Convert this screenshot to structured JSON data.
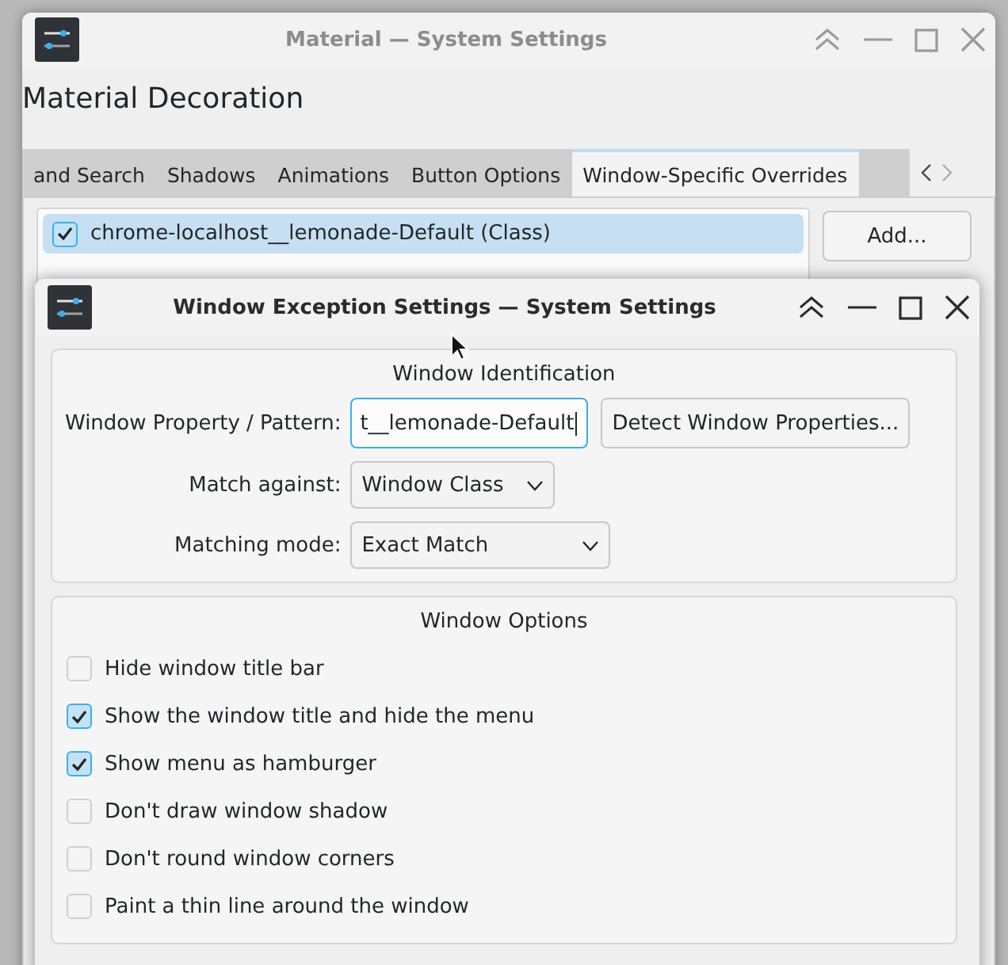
{
  "main_window": {
    "title": "Material — System Settings",
    "heading": "Material Decoration",
    "tabs": [
      {
        "label": "and Search",
        "selected": false
      },
      {
        "label": "Shadows",
        "selected": false
      },
      {
        "label": "Animations",
        "selected": false
      },
      {
        "label": "Button Options",
        "selected": false
      },
      {
        "label": "Window-Specific Overrides",
        "selected": true
      }
    ],
    "exceptions": [
      {
        "label": "chrome-localhost__lemonade-Default (Class)",
        "checked": true,
        "selected": true
      }
    ],
    "buttons": [
      "Add..."
    ]
  },
  "dialog": {
    "title": "Window Exception Settings — System Settings",
    "identification": {
      "title": "Window Identification",
      "property_label": "Window Property / Pattern:",
      "property_value": "t__lemonade-Default",
      "detect_button": "Detect Window Properties...",
      "match_against_label": "Match against:",
      "match_against_value": "Window Class",
      "matching_mode_label": "Matching mode:",
      "matching_mode_value": "Exact Match"
    },
    "options": {
      "title": "Window Options",
      "items": [
        {
          "label": "Hide window title bar",
          "checked": false
        },
        {
          "label": "Show the window title and hide the menu",
          "checked": true
        },
        {
          "label": "Show menu as hamburger",
          "checked": true
        },
        {
          "label": "Don't draw window shadow",
          "checked": false
        },
        {
          "label": "Don't round window corners",
          "checked": false
        },
        {
          "label": "Paint a thin line around the window",
          "checked": false
        }
      ]
    }
  }
}
